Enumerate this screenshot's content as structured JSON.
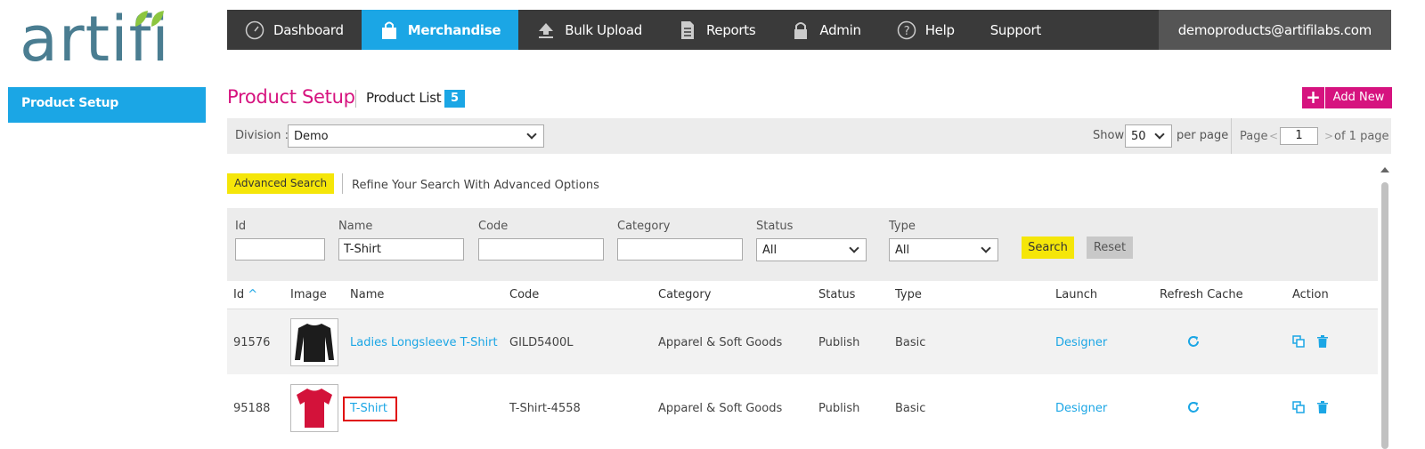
{
  "logo": {
    "text": "artifi"
  },
  "sidebar": {
    "items": [
      {
        "label": "Product Setup"
      }
    ]
  },
  "nav": {
    "items": [
      {
        "label": "Dashboard",
        "icon": "dashboard-gauge-icon"
      },
      {
        "label": "Merchandise",
        "icon": "shopping-bag-icon"
      },
      {
        "label": "Bulk Upload",
        "icon": "upload-icon"
      },
      {
        "label": "Reports",
        "icon": "document-icon"
      },
      {
        "label": "Admin",
        "icon": "lock-icon"
      },
      {
        "label": "Help",
        "icon": "question-icon"
      },
      {
        "label": "Support",
        "icon": ""
      }
    ],
    "user": "demoproducts@artifilabs.com"
  },
  "page": {
    "title": "Product Setup",
    "subtitle": "Product List",
    "count": "5",
    "add_new": "Add New",
    "add_plus": "+"
  },
  "division": {
    "label": "Division :",
    "value": "Demo"
  },
  "paging": {
    "show": "Show",
    "per_page_value": "50",
    "per_page": "per page",
    "page": "Page",
    "prev": "<",
    "current": "1",
    "next": ">",
    "of": "of 1 page"
  },
  "advanced": {
    "button": "Advanced Search",
    "hint": "Refine Your Search With Advanced Options"
  },
  "filters": {
    "id": {
      "label": "Id",
      "value": ""
    },
    "name": {
      "label": "Name",
      "value": "T-Shirt"
    },
    "code": {
      "label": "Code",
      "value": ""
    },
    "category": {
      "label": "Category",
      "value": ""
    },
    "status": {
      "label": "Status",
      "value": "All"
    },
    "type": {
      "label": "Type",
      "value": "All"
    },
    "search": "Search",
    "reset": "Reset"
  },
  "table": {
    "headers": {
      "id": "Id",
      "sort_arrow": "^",
      "image": "Image",
      "name": "Name",
      "code": "Code",
      "category": "Category",
      "status": "Status",
      "type": "Type",
      "launch": "Launch",
      "refresh": "Refresh Cache",
      "action": "Action"
    },
    "rows": [
      {
        "id": "91576",
        "name": "Ladies Longsleeve T-Shirt",
        "code": "GILD5400L",
        "category": "Apparel & Soft Goods",
        "status": "Publish",
        "type": "Basic",
        "launch": "Designer",
        "shirt_color": "#1c1c1c"
      },
      {
        "id": "95188",
        "name": "T-Shirt",
        "code": "T-Shirt-4558",
        "category": "Apparel & Soft Goods",
        "status": "Publish",
        "type": "Basic",
        "launch": "Designer",
        "shirt_color": "#d3123a"
      }
    ]
  },
  "colors": {
    "accent": "#1ba6e5",
    "brand": "#d6137f",
    "highlight": "#f5e609",
    "nav_bg": "#3a3a3a"
  }
}
